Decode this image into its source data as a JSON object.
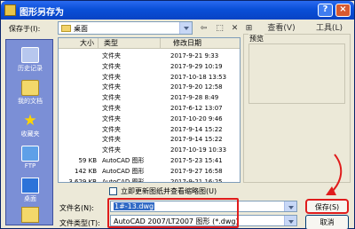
{
  "title": "图形另存为",
  "help_glyph": "?",
  "close_glyph": "×",
  "save_in_label": "保存于(I):",
  "location": "桌面",
  "toolbar": [
    "⇦",
    "⬚",
    "✕",
    "⊞",
    "查看(V)",
    "工具(L)"
  ],
  "places": [
    "历史记录",
    "我的文档",
    "收藏夹",
    "FTP",
    "桌面",
    ""
  ],
  "columns": {
    "size": "大小",
    "type": "类型",
    "modified": "修改日期"
  },
  "files": [
    {
      "size": "",
      "type": "文件夹",
      "date": "2017-9-21 9:33"
    },
    {
      "size": "",
      "type": "文件夹",
      "date": "2017-9-29 10:19"
    },
    {
      "size": "",
      "type": "文件夹",
      "date": "2017-10-18 13:53"
    },
    {
      "size": "",
      "type": "文件夹",
      "date": "2017-9-20 12:58"
    },
    {
      "size": "",
      "type": "文件夹",
      "date": "2017-9-28 8:49"
    },
    {
      "size": "",
      "type": "文件夹",
      "date": "2017-6-12 13:07"
    },
    {
      "size": "",
      "type": "文件夹",
      "date": "2017-10-20 9:46"
    },
    {
      "size": "",
      "type": "文件夹",
      "date": "2017-9-14 15:22"
    },
    {
      "size": "",
      "type": "文件夹",
      "date": "2017-9-14 15:22"
    },
    {
      "size": "",
      "type": "文件夹",
      "date": "2017-10-19 10:33"
    },
    {
      "size": "59 KB",
      "type": "AutoCAD 图形",
      "date": "2017-5-23 15:41"
    },
    {
      "size": "142 KB",
      "type": "AutoCAD 图形",
      "date": "2017-9-27 16:58"
    },
    {
      "size": "3,629 KB",
      "type": "AutoCAD 图形",
      "date": "2017-9-21 16:25"
    }
  ],
  "preview_label": "预览",
  "checkbox_label": "立即更新图纸并查看缩略图(U)",
  "filename_label": "文件名(N):",
  "filename_value": "1#-13.dwg",
  "filetype_label": "文件类型(T):",
  "filetype_value": "AutoCAD 2007/LT2007 图形 (*.dwg)",
  "save_button": "保存(S)",
  "cancel_button": "取消",
  "accent_colors": {
    "title_bar": "#0a4fd8",
    "highlight": "#e01c1c",
    "selection": "#316ac5"
  }
}
